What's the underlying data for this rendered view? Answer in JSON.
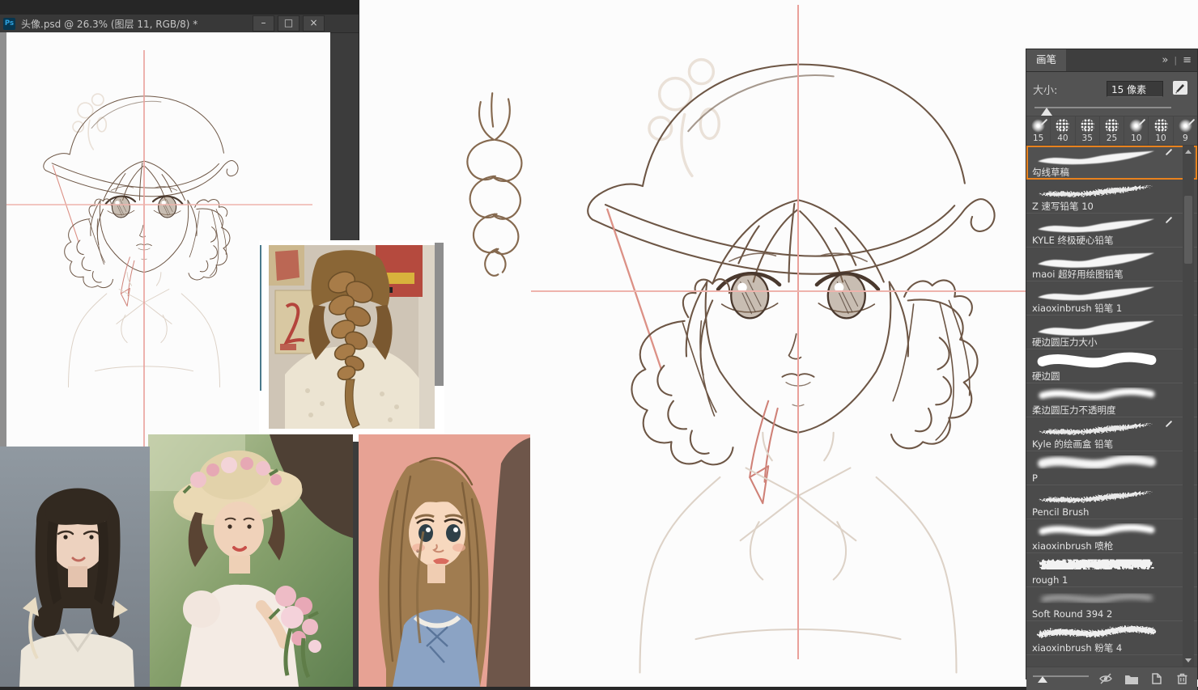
{
  "window": {
    "app_badge": "Ps",
    "title": "头像.psd @ 26.3% (图层 11, RGB/8) *",
    "controls": {
      "minimize": "–",
      "maximize": "□",
      "close": "×"
    }
  },
  "panel": {
    "tab": "画笔",
    "collapse_icon": "»",
    "menu_sep": "|",
    "menu_icon": "≡",
    "size_label": "大小:",
    "size_value": "15 像素",
    "presets": [
      {
        "size": "15",
        "tex": false,
        "pen": true
      },
      {
        "size": "40",
        "tex": true,
        "pen": false
      },
      {
        "size": "35",
        "tex": true,
        "pen": false
      },
      {
        "size": "25",
        "tex": true,
        "pen": false
      },
      {
        "size": "10",
        "tex": false,
        "pen": true
      },
      {
        "size": "10",
        "tex": true,
        "pen": false
      },
      {
        "size": "9",
        "tex": false,
        "pen": true
      }
    ],
    "brushes": [
      {
        "name": "勾线草稿",
        "stroke": "#st-taper",
        "selected": true,
        "pen": true
      },
      {
        "name": "Z 速写铅笔 10",
        "stroke": "#st-thin",
        "selected": false,
        "pen": false
      },
      {
        "name": "KYLE 终极硬心铅笔",
        "stroke": "#st-taper",
        "selected": false,
        "pen": true
      },
      {
        "name": "maoi 超好用绘图铅笔",
        "stroke": "#st-taper2",
        "selected": false,
        "pen": false
      },
      {
        "name": "xiaoxinbrush 铅笔 1",
        "stroke": "#st-taper",
        "selected": false,
        "pen": false
      },
      {
        "name": "硬边圆压力大小",
        "stroke": "#st-taper2",
        "selected": false,
        "pen": false
      },
      {
        "name": "硬边圆",
        "stroke": "#st-solid",
        "selected": false,
        "pen": false
      },
      {
        "name": "柔边圆压力不透明度",
        "stroke": "#st-soft",
        "selected": false,
        "pen": false
      },
      {
        "name": "Kyle 的绘画盒 铅笔",
        "stroke": "#st-thin",
        "selected": false,
        "pen": true
      },
      {
        "name": "P",
        "stroke": "#st-soft2",
        "selected": false,
        "pen": false
      },
      {
        "name": "Pencil Brush",
        "stroke": "#st-thin",
        "selected": false,
        "pen": false
      },
      {
        "name": "xiaoxinbrush 喷枪",
        "stroke": "#st-soft",
        "selected": false,
        "pen": false
      },
      {
        "name": "rough 1",
        "stroke": "#st-rough",
        "selected": false,
        "pen": false
      },
      {
        "name": "Soft Round 394 2",
        "stroke": "#st-faint",
        "selected": false,
        "pen": false
      },
      {
        "name": "xiaoxinbrush 粉笔 4",
        "stroke": "#st-chalk",
        "selected": false,
        "pen": false
      }
    ]
  },
  "colors": {
    "accent_orange": "#e8821e",
    "guide_pink": "#e9a09a",
    "sketch_line": "#6d5645",
    "panel_bg": "#535353",
    "canvas_white": "#fcfcfc"
  }
}
